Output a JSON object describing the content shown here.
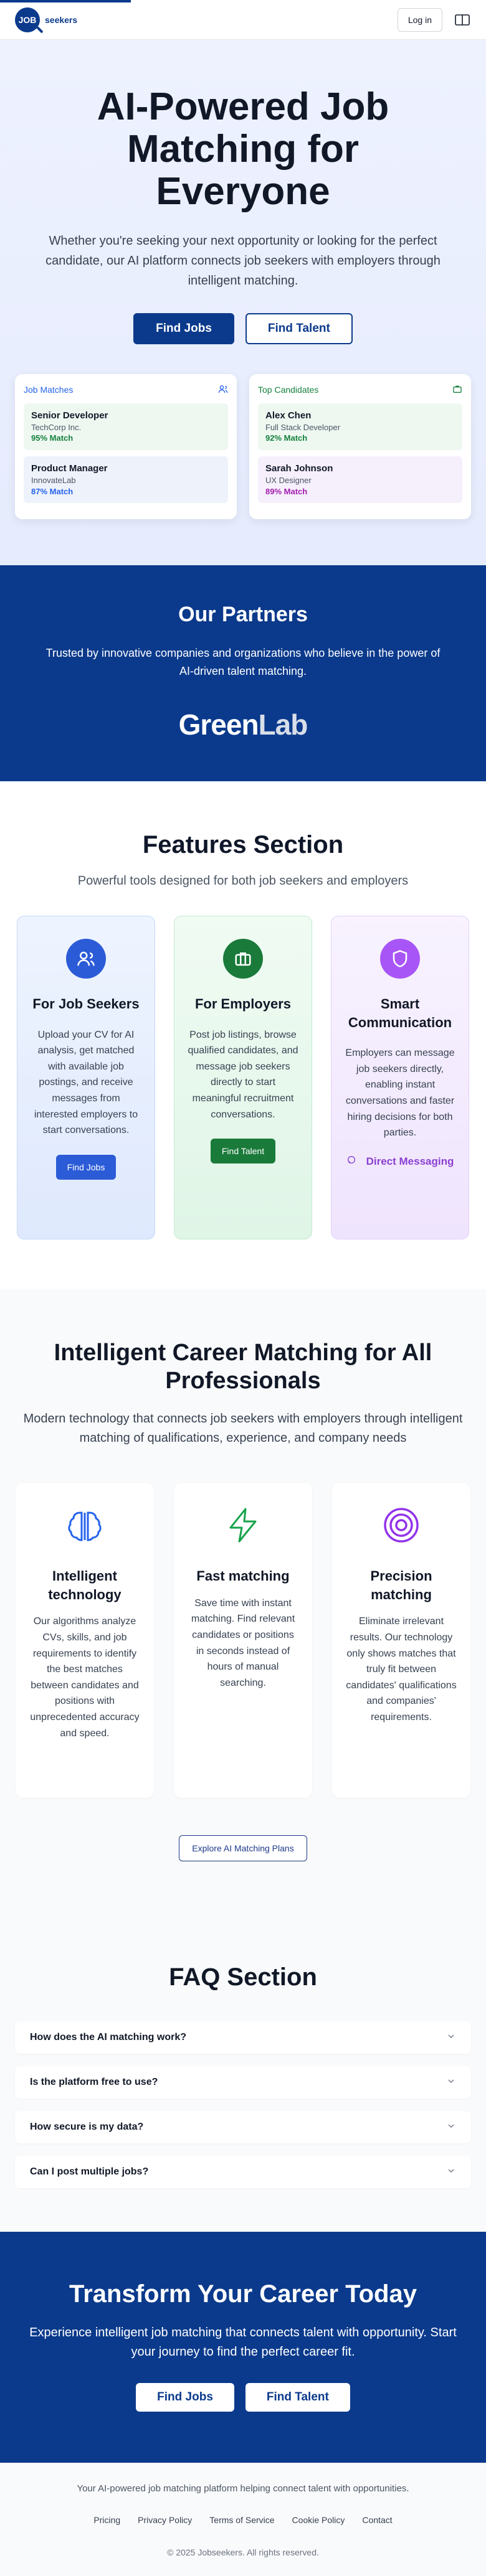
{
  "header": {
    "logo_badge": "JOB",
    "logo_text": "seekers",
    "login_label": "Log in"
  },
  "hero": {
    "title": "AI-Powered Job Matching for Everyone",
    "subtitle": "Whether you're seeking your next opportunity or looking for the perfect candidate, our AI platform connects job seekers with employers through intelligent matching.",
    "find_jobs_label": "Find Jobs",
    "find_talent_label": "Find Talent",
    "job_matches": {
      "title": "Job Matches",
      "items": [
        {
          "role": "Senior Developer",
          "company": "TechCorp Inc.",
          "match": "95% Match"
        },
        {
          "role": "Product Manager",
          "company": "InnovateLab",
          "match": "87% Match"
        }
      ]
    },
    "top_candidates": {
      "title": "Top Candidates",
      "items": [
        {
          "name": "Alex Chen",
          "role": "Full Stack Developer",
          "match": "92% Match"
        },
        {
          "name": "Sarah Johnson",
          "role": "UX Designer",
          "match": "89% Match"
        }
      ]
    }
  },
  "partners": {
    "title": "Our Partners",
    "subtitle": "Trusted by innovative companies and organizations who believe in the power of AI-driven talent matching.",
    "logo_part1": "Green",
    "logo_part2": "Lab"
  },
  "features": {
    "title": "Features Section",
    "subtitle": "Powerful tools designed for both job seekers and employers",
    "cards": [
      {
        "title": "For Job Seekers",
        "text": "Upload your CV for AI analysis, get matched with available job postings, and receive messages from interested employers to start conversations.",
        "button": "Find Jobs",
        "icon": "users-icon"
      },
      {
        "title": "For Employers",
        "text": "Post job listings, browse qualified candidates, and message job seekers directly to start meaningful recruitment conversations.",
        "button": "Find Talent",
        "icon": "briefcase-icon"
      },
      {
        "title": "Smart Communication",
        "text": "Employers can message job seekers directly, enabling instant conversations and faster hiring decisions for both parties.",
        "link": "Direct Messaging",
        "icon": "shield-icon"
      }
    ]
  },
  "career": {
    "title": "Intelligent Career Matching for All Professionals",
    "subtitle": "Modern technology that connects job seekers with employers through intelligent matching of qualifications, experience, and company needs",
    "cards": [
      {
        "title": "Intelligent technology",
        "text": "Our algorithms analyze CVs, skills, and job requirements to identify the best matches between candidates and positions with unprecedented accuracy and speed.",
        "icon": "brain-icon"
      },
      {
        "title": "Fast matching",
        "text": "Save time with instant matching. Find relevant candidates or positions in seconds instead of hours of manual searching.",
        "icon": "lightning-icon"
      },
      {
        "title": "Precision matching",
        "text": "Eliminate irrelevant results. Our technology only shows matches that truly fit between candidates' qualifications and companies' requirements.",
        "icon": "target-icon"
      }
    ],
    "explore_label": "Explore AI Matching Plans"
  },
  "faq": {
    "title": "FAQ Section",
    "items": [
      "How does the AI matching work?",
      "Is the platform free to use?",
      "How secure is my data?",
      "Can I post multiple jobs?"
    ]
  },
  "cta": {
    "title": "Transform Your Career Today",
    "subtitle": "Experience intelligent job matching that connects talent with opportunity. Start your journey to find the perfect career fit.",
    "find_jobs_label": "Find Jobs",
    "find_talent_label": "Find Talent"
  },
  "footer": {
    "tagline": "Your AI-powered job matching platform helping connect talent with opportunities.",
    "links": [
      "Pricing",
      "Privacy Policy",
      "Terms of Service",
      "Cookie Policy",
      "Contact"
    ],
    "copyright": "© 2025 Jobseekers. All rights reserved."
  },
  "colors": {
    "brand": "#0b3a8c",
    "blue_accent": "#2563eb",
    "green_accent": "#15803d",
    "purple_accent": "#a855f7"
  }
}
